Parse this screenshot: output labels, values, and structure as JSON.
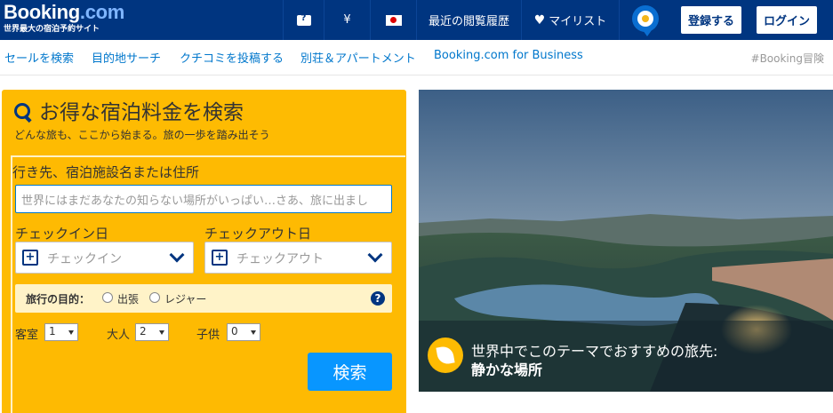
{
  "header": {
    "logo_main": "Booking",
    "logo_dotcom": ".com",
    "logo_tagline": "世界最大の宿泊予約サイト",
    "currency": "¥",
    "recently_viewed": "最近の閲覧履歴",
    "my_list": "マイリスト",
    "register": "登録する",
    "login": "ログイン"
  },
  "subnav": {
    "items": [
      "セールを検索",
      "目的地サーチ",
      "クチコミを投稿する",
      "別荘＆アパートメント",
      "Booking.com for Business"
    ],
    "right": "#Booking冒険"
  },
  "search": {
    "title": "お得な宿泊料金を検索",
    "subtitle": "どんな旅も、ここから始まる。旅の一歩を踏み出そう",
    "destination_label": "行き先、宿泊施設名または住所",
    "destination_placeholder": "世界にはまだあなたの知らない場所がいっぱい…さあ、旅に出まし",
    "checkin_label": "チェックイン日",
    "checkin_placeholder": "チェックイン",
    "checkout_label": "チェックアウト日",
    "checkout_placeholder": "チェックアウト",
    "purpose_label": "旅行の目的：",
    "purpose_business": "出張",
    "purpose_leisure": "レジャー",
    "help": "?",
    "rooms_label": "客室",
    "rooms_value": "1",
    "adults_label": "大人",
    "adults_value": "2",
    "children_label": "子供",
    "children_value": "0",
    "button": "検索"
  },
  "hero": {
    "caption_line1": "世界中でこのテーマでおすすめの旅先:",
    "caption_line2": "静かな場所"
  },
  "colors": {
    "brand_navy": "#003580",
    "accent_yellow": "#febb02",
    "button_blue": "#0896ff",
    "link_blue": "#0077cc"
  }
}
